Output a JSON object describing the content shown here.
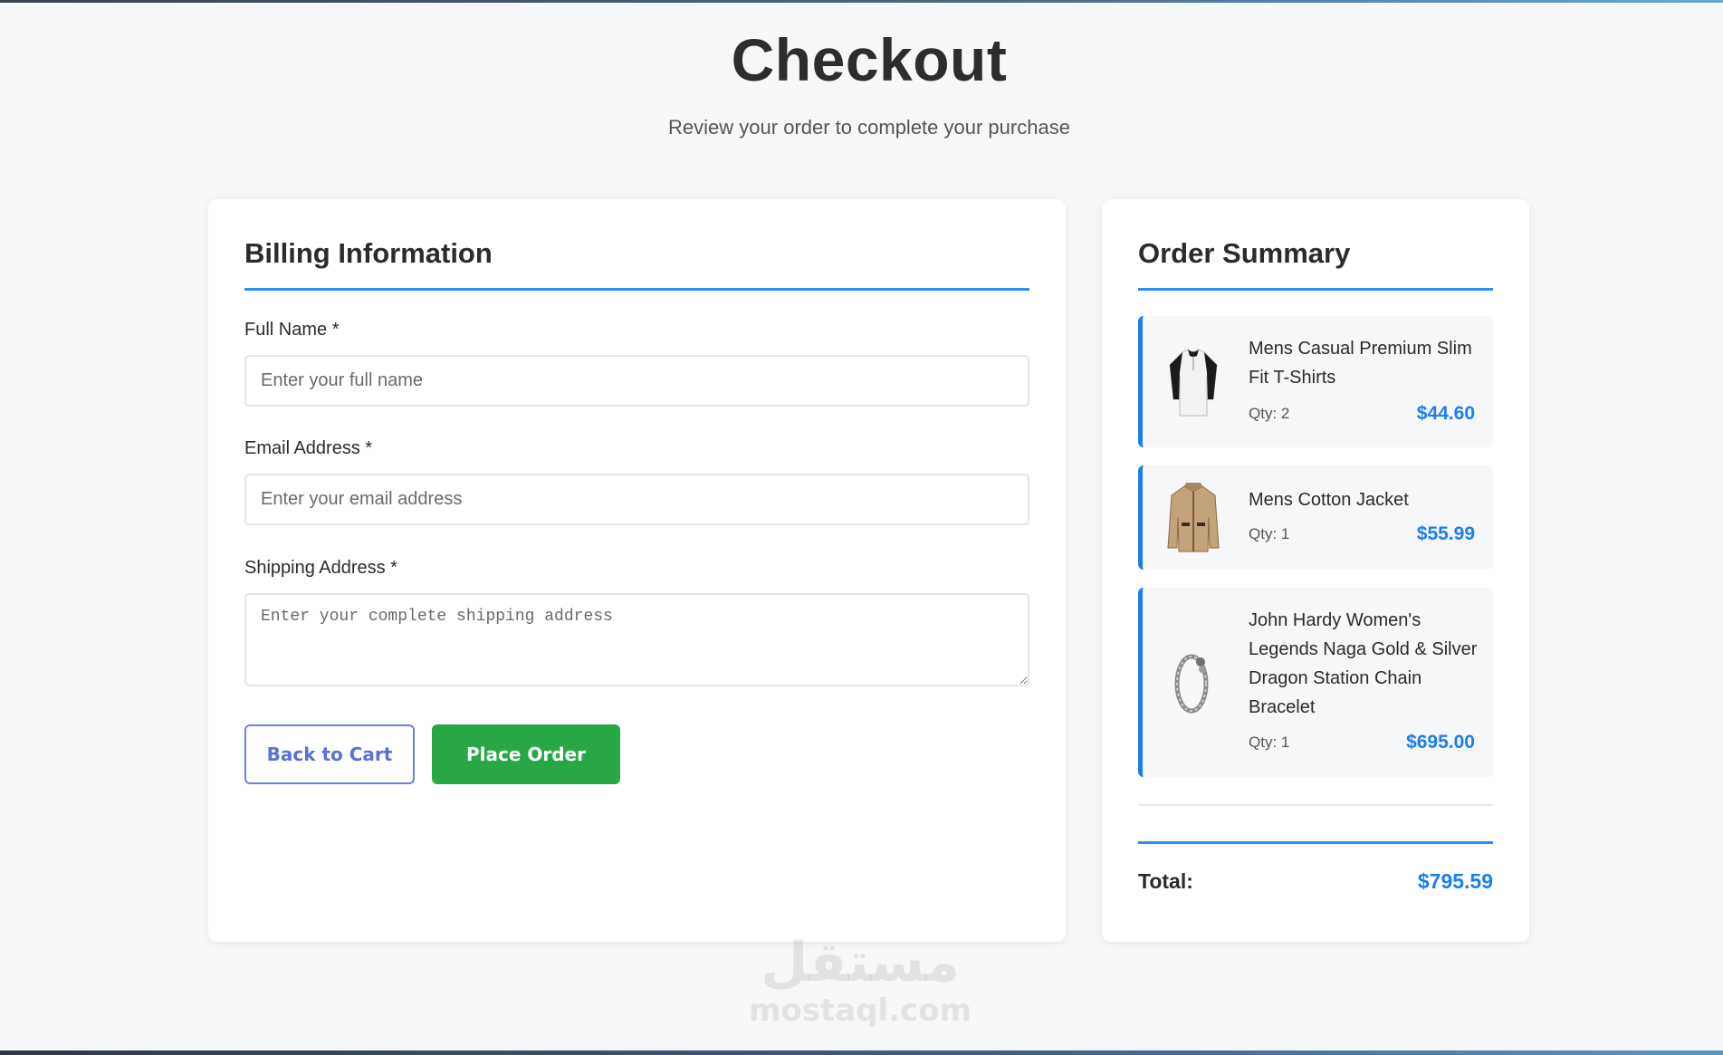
{
  "page": {
    "title": "Checkout",
    "subtitle": "Review your order to complete your purchase"
  },
  "billing": {
    "title": "Billing Information",
    "full_name": {
      "label": "Full Name *",
      "placeholder": "Enter your full name",
      "value": ""
    },
    "email": {
      "label": "Email Address *",
      "placeholder": "Enter your email address",
      "value": ""
    },
    "address": {
      "label": "Shipping Address *",
      "placeholder": "Enter your complete shipping address",
      "value": ""
    },
    "back_label": "Back to Cart",
    "place_label": "Place Order"
  },
  "summary": {
    "title": "Order Summary",
    "items": [
      {
        "name": "Mens Casual Premium Slim Fit T-Shirts",
        "qty": "Qty: 2",
        "price": "$44.60",
        "icon": "tshirt-icon"
      },
      {
        "name": "Mens Cotton Jacket",
        "qty": "Qty: 1",
        "price": "$55.99",
        "icon": "jacket-icon"
      },
      {
        "name": "John Hardy Women's Legends Naga Gold & Silver Dragon Station Chain Bracelet",
        "qty": "Qty: 1",
        "price": "$695.00",
        "icon": "bracelet-icon"
      }
    ],
    "total_label": "Total:",
    "total_value": "$795.59"
  },
  "watermark": {
    "arabic": "مستقل",
    "latin": "mostaql.com"
  },
  "colors": {
    "accent": "#1a7ef0",
    "success": "#28a745",
    "secondary_button": "#5a6fdc",
    "background": "#f6f7f9"
  }
}
